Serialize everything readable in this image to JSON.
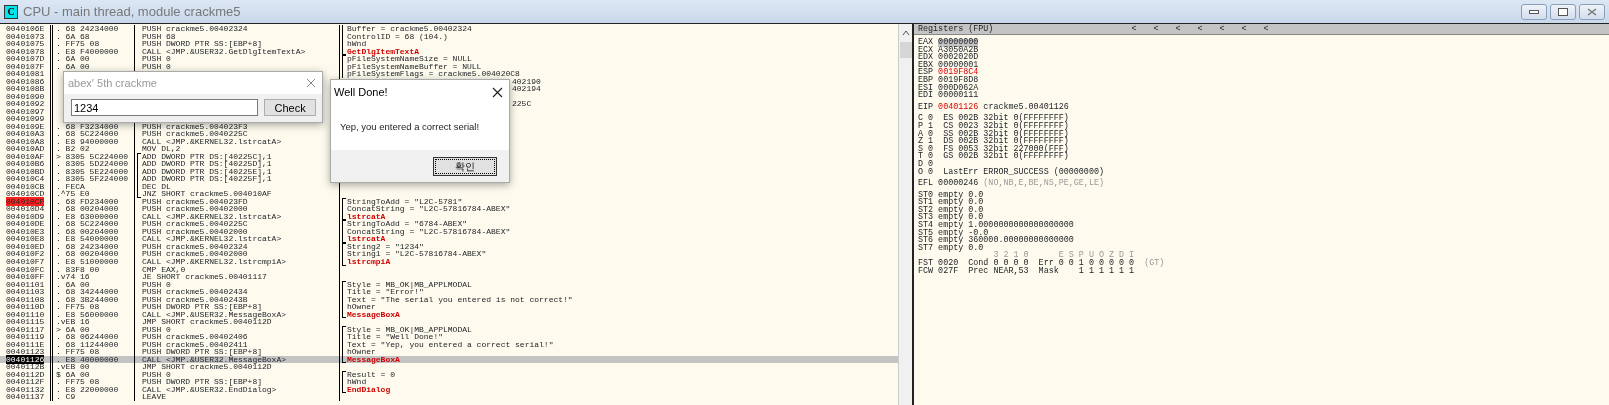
{
  "window": {
    "icon_letter": "C",
    "title": "CPU - main thread, module crackme5"
  },
  "disassembly": {
    "rows": [
      {
        "addr": "0040106E",
        "hex": ". 68 24234000",
        "cmd": "PUSH crackme5.00402324",
        "comment": {
          "text": "Buffer = crackme5.00402324",
          "kind": "arg",
          "bracket_start": false,
          "bracket_end": false
        },
        "selected": false,
        "breakpoint": false,
        "eip": false
      },
      {
        "addr": "00401073",
        "hex": ". 6A 68",
        "cmd": "PUSH 68",
        "comment": {
          "text": "ControlID = 68 (104.)",
          "kind": "arg",
          "bracket_start": false,
          "bracket_end": false
        },
        "selected": false,
        "breakpoint": false,
        "eip": false
      },
      {
        "addr": "00401075",
        "hex": ". FF75 08",
        "cmd": "PUSH DWORD PTR SS:[EBP+8]",
        "comment": {
          "text": "hWnd",
          "kind": "arg",
          "bracket_start": false,
          "bracket_end": false
        },
        "selected": false,
        "breakpoint": false,
        "eip": false
      },
      {
        "addr": "00401078",
        "hex": ". E8 F4000000",
        "cmd": "CALL <JMP.&USER32.GetDlgItemTextA>",
        "comment": {
          "text": "GetDlgItemTextA",
          "kind": "api",
          "bracket_start": false,
          "bracket_end": true
        },
        "selected": false,
        "breakpoint": false,
        "eip": false
      },
      {
        "addr": "0040107D",
        "hex": ". 6A 00",
        "cmd": "PUSH 0",
        "comment": {
          "text": "pFileSystemNameSize = NULL",
          "kind": "arg",
          "bracket_start": true,
          "bracket_end": false
        },
        "selected": false,
        "breakpoint": false,
        "eip": false
      },
      {
        "addr": "0040107F",
        "hex": ". 6A 00",
        "cmd": "PUSH 0",
        "comment": {
          "text": "pFileSystemNameBuffer = NULL",
          "kind": "arg",
          "bracket_start": false,
          "bracket_end": false
        },
        "selected": false,
        "breakpoint": false,
        "eip": false
      },
      {
        "addr": "00401081",
        "comment": {
          "text": "pFileSystemFlags = crackme5.004020C8",
          "kind": "arg",
          "bracket_start": false,
          "bracket_end": false
        },
        "selected": false,
        "breakpoint": false,
        "eip": false
      },
      {
        "addr": "00401086",
        "comment": {
          "text": "402190",
          "kind": "partial"
        },
        "selected": false,
        "breakpoint": false,
        "eip": false
      },
      {
        "addr": "0040108B",
        "comment": {
          "text": "402194",
          "kind": "partial"
        },
        "selected": false,
        "breakpoint": false,
        "eip": false
      },
      {
        "addr": "00401090",
        "selected": false,
        "breakpoint": false,
        "eip": false
      },
      {
        "addr": "00401092",
        "comment": {
          "text": "225C",
          "kind": "partial"
        },
        "selected": false,
        "breakpoint": false,
        "eip": false
      },
      {
        "addr": "00401097",
        "selected": false,
        "breakpoint": false,
        "eip": false
      },
      {
        "addr": "00401099",
        "selected": false,
        "breakpoint": false,
        "eip": false
      },
      {
        "addr": "0040109E",
        "hex": ". 68 F3234000",
        "cmd": "PUSH crackme5.004023F3",
        "selected": false,
        "breakpoint": false,
        "eip": false
      },
      {
        "addr": "004010A3",
        "hex": ". 68 5C224000",
        "cmd": "PUSH crackme5.0040225C",
        "selected": false,
        "breakpoint": false,
        "eip": false
      },
      {
        "addr": "004010A8",
        "hex": ". E8 94000000",
        "cmd": "CALL <JMP.&KERNEL32.lstrcatA>",
        "selected": false,
        "breakpoint": false,
        "eip": false
      },
      {
        "addr": "004010AD",
        "hex": ". B2 02",
        "cmd": "MOV DL,2",
        "selected": false,
        "breakpoint": false,
        "eip": false
      },
      {
        "addr": "004010AF",
        "hex": "> 8305 5C224000",
        "cmd": "ADD DWORD PTR DS:[40225C],1",
        "loop": {
          "start": true,
          "end": false
        },
        "selected": false,
        "breakpoint": false,
        "eip": false
      },
      {
        "addr": "004010B6",
        "hex": ". 8305 5D224000",
        "cmd": "ADD DWORD PTR DS:[40225D],1",
        "loop": {
          "start": false,
          "end": false
        },
        "selected": false,
        "breakpoint": false,
        "eip": false
      },
      {
        "addr": "004010BD",
        "hex": ". 8305 5E224000",
        "cmd": "ADD DWORD PTR DS:[40225E],1",
        "loop": {
          "start": false,
          "end": false
        },
        "selected": false,
        "breakpoint": false,
        "eip": false
      },
      {
        "addr": "004010C4",
        "hex": ". 8305 5F224000",
        "cmd": "ADD DWORD PTR DS:[40225F],1",
        "loop": {
          "start": false,
          "end": false
        },
        "selected": false,
        "breakpoint": false,
        "eip": false
      },
      {
        "addr": "004010CB",
        "hex": ". FECA",
        "cmd": "DEC DL",
        "loop": {
          "start": false,
          "end": false
        },
        "selected": false,
        "breakpoint": false,
        "eip": false
      },
      {
        "addr": "004010CD",
        "hex": ".^75 E0",
        "cmd": "JNZ SHORT crackme5.004010AF",
        "loop": {
          "start": false,
          "end": true
        },
        "selected": false,
        "breakpoint": false,
        "eip": false
      },
      {
        "addr": "004010CF",
        "hex": ". 68 FD234000",
        "cmd": "PUSH crackme5.004023FD",
        "comment": {
          "text": "StringToAdd = \"L2C-5781\"",
          "kind": "arg",
          "bracket_start": true,
          "bracket_end": false
        },
        "selected": false,
        "breakpoint": true,
        "eip": false
      },
      {
        "addr": "004010D4",
        "hex": ". 68 00204000",
        "cmd": "PUSH crackme5.00402000",
        "comment": {
          "text": "ConcatString = \"L2C-57816784-ABEX\"",
          "kind": "arg",
          "bracket_start": false,
          "bracket_end": false
        },
        "selected": false,
        "breakpoint": false,
        "eip": false
      },
      {
        "addr": "004010D9",
        "hex": ". E8 63000000",
        "cmd": "CALL <JMP.&KERNEL32.lstrcatA>",
        "comment": {
          "text": "lstrcatA",
          "kind": "api",
          "bracket_start": false,
          "bracket_end": true
        },
        "selected": false,
        "breakpoint": false,
        "eip": false
      },
      {
        "addr": "004010DE",
        "hex": ". 68 5C224000",
        "cmd": "PUSH crackme5.0040225C",
        "comment": {
          "text": "StringToAdd = \"6784-ABEX\"",
          "kind": "arg",
          "bracket_start": true,
          "bracket_end": false
        },
        "selected": false,
        "breakpoint": false,
        "eip": false
      },
      {
        "addr": "004010E3",
        "hex": ". 68 00204000",
        "cmd": "PUSH crackme5.00402000",
        "comment": {
          "text": "ConcatString = \"L2C-57816784-ABEX\"",
          "kind": "arg",
          "bracket_start": false,
          "bracket_end": false
        },
        "selected": false,
        "breakpoint": false,
        "eip": false
      },
      {
        "addr": "004010E8",
        "hex": ". E8 54000000",
        "cmd": "CALL <JMP.&KERNEL32.lstrcatA>",
        "comment": {
          "text": "lstrcatA",
          "kind": "api",
          "bracket_start": false,
          "bracket_end": true
        },
        "selected": false,
        "breakpoint": false,
        "eip": false
      },
      {
        "addr": "004010ED",
        "hex": ". 68 24234000",
        "cmd": "PUSH crackme5.00402324",
        "comment": {
          "text": "String2 = \"1234\"",
          "kind": "arg",
          "bracket_start": true,
          "bracket_end": false
        },
        "selected": false,
        "breakpoint": false,
        "eip": false
      },
      {
        "addr": "004010F2",
        "hex": ". 68 00204000",
        "cmd": "PUSH crackme5.00402000",
        "comment": {
          "text": "String1 = \"L2C-57816784-ABEX\"",
          "kind": "arg",
          "bracket_start": false,
          "bracket_end": false
        },
        "selected": false,
        "breakpoint": false,
        "eip": false
      },
      {
        "addr": "004010F7",
        "hex": ". E8 51000000",
        "cmd": "CALL <JMP.&KERNEL32.lstrcmpiA>",
        "comment": {
          "text": "lstrcmpiA",
          "kind": "api",
          "bracket_start": false,
          "bracket_end": true
        },
        "selected": false,
        "breakpoint": false,
        "eip": false
      },
      {
        "addr": "004010FC",
        "hex": ". 83F8 00",
        "cmd": "CMP EAX,0",
        "selected": false,
        "breakpoint": false,
        "eip": false
      },
      {
        "addr": "004010FF",
        "hex": ".v74 16",
        "cmd": "JE SHORT crackme5.00401117",
        "selected": false,
        "breakpoint": false,
        "eip": false
      },
      {
        "addr": "00401101",
        "hex": ". 6A 00",
        "cmd": "PUSH 0",
        "comment": {
          "text": "Style = MB_OK|MB_APPLMODAL",
          "kind": "arg",
          "bracket_start": true,
          "bracket_end": false
        },
        "selected": false,
        "breakpoint": false,
        "eip": false
      },
      {
        "addr": "00401103",
        "hex": ". 68 34244000",
        "cmd": "PUSH crackme5.00402434",
        "comment": {
          "text": "Title = \"Error!\"",
          "kind": "arg",
          "bracket_start": false,
          "bracket_end": false
        },
        "selected": false,
        "breakpoint": false,
        "eip": false
      },
      {
        "addr": "00401108",
        "hex": ". 68 3B244000",
        "cmd": "PUSH crackme5.0040243B",
        "comment": {
          "text": "Text = \"The serial you entered is not correct!\"",
          "kind": "arg",
          "bracket_start": false,
          "bracket_end": false
        },
        "selected": false,
        "breakpoint": false,
        "eip": false
      },
      {
        "addr": "0040110D",
        "hex": ". FF75 08",
        "cmd": "PUSH DWORD PTR SS:[EBP+8]",
        "comment": {
          "text": "hOwner",
          "kind": "arg",
          "bracket_start": false,
          "bracket_end": false
        },
        "selected": false,
        "breakpoint": false,
        "eip": false
      },
      {
        "addr": "00401110",
        "hex": ". E8 56000000",
        "cmd": "CALL <JMP.&USER32.MessageBoxA>",
        "comment": {
          "text": "MessageBoxA",
          "kind": "api",
          "bracket_start": false,
          "bracket_end": true
        },
        "selected": false,
        "breakpoint": false,
        "eip": false
      },
      {
        "addr": "00401115",
        "hex": ".vEB 16",
        "cmd": "JMP SHORT crackme5.0040112D",
        "selected": false,
        "breakpoint": false,
        "eip": false
      },
      {
        "addr": "00401117",
        "hex": "> 6A 00",
        "cmd": "PUSH 0",
        "comment": {
          "text": "Style = MB_OK|MB_APPLMODAL",
          "kind": "arg",
          "bracket_start": true,
          "bracket_end": false
        },
        "selected": false,
        "breakpoint": false,
        "eip": false
      },
      {
        "addr": "00401119",
        "hex": ". 68 06244000",
        "cmd": "PUSH crackme5.00402406",
        "comment": {
          "text": "Title = \"Well Done!\"",
          "kind": "arg",
          "bracket_start": false,
          "bracket_end": false
        },
        "selected": false,
        "breakpoint": false,
        "eip": false
      },
      {
        "addr": "0040111E",
        "hex": ". 68 11244000",
        "cmd": "PUSH crackme5.00402411",
        "comment": {
          "text": "Text = \"Yep, you entered a correct serial!\"",
          "kind": "arg",
          "bracket_start": false,
          "bracket_end": false
        },
        "selected": false,
        "breakpoint": false,
        "eip": false
      },
      {
        "addr": "00401123",
        "hex": ". FF75 08",
        "cmd": "PUSH DWORD PTR SS:[EBP+8]",
        "comment": {
          "text": "hOwner",
          "kind": "arg",
          "bracket_start": false,
          "bracket_end": false
        },
        "selected": false,
        "breakpoint": false,
        "eip": false
      },
      {
        "addr": "00401126",
        "hex": ". E8 40000000",
        "cmd": "CALL <JMP.&USER32.MessageBoxA>",
        "comment": {
          "text": "MessageBoxA",
          "kind": "api",
          "bracket_start": false,
          "bracket_end": true
        },
        "selected": true,
        "breakpoint": false,
        "eip": true
      },
      {
        "addr": "0040112B",
        "hex": ".vEB 00",
        "cmd": "JMP SHORT crackme5.0040112D",
        "selected": false,
        "breakpoint": false,
        "eip": false
      },
      {
        "addr": "0040112D",
        "hex": "$ 6A 00",
        "cmd": "PUSH 0",
        "comment": {
          "text": "Result = 0",
          "kind": "arg",
          "bracket_start": true,
          "bracket_end": false
        },
        "selected": false,
        "breakpoint": false,
        "eip": false
      },
      {
        "addr": "0040112F",
        "hex": ". FF75 08",
        "cmd": "PUSH DWORD PTR SS:[EBP+8]",
        "comment": {
          "text": "hWnd",
          "kind": "arg",
          "bracket_start": false,
          "bracket_end": false
        },
        "selected": false,
        "breakpoint": false,
        "eip": false
      },
      {
        "addr": "00401132",
        "hex": ". E8 22000000",
        "cmd": "CALL <JMP.&USER32.EndDialog>",
        "comment": {
          "text": "EndDialog",
          "kind": "api",
          "bracket_start": false,
          "bracket_end": true
        },
        "selected": false,
        "breakpoint": false,
        "eip": false
      },
      {
        "addr": "00401137",
        "hex": ". C9",
        "cmd": "LEAVE",
        "selected": false,
        "breakpoint": false,
        "eip": false
      }
    ]
  },
  "registers": {
    "title": "Registers (FPU)",
    "arrows": [
      "<",
      "<",
      "<",
      "<",
      "<",
      "<",
      "<"
    ],
    "groups": [
      [
        [
          {
            "t": "EAX "
          },
          {
            "t": "00000000",
            "kind": "selected"
          }
        ],
        [
          {
            "t": "ECX A3050A2B"
          }
        ],
        [
          {
            "t": "EDX 0002020D"
          }
        ],
        [
          {
            "t": "EBX 00000001"
          }
        ],
        [
          {
            "t": "ESP "
          },
          {
            "t": "0019F8C4",
            "kind": "changed"
          }
        ],
        [
          {
            "t": "EBP 0019F8D8"
          }
        ],
        [
          {
            "t": "ESI 000D062A"
          }
        ],
        [
          {
            "t": "EDI 00000111"
          }
        ]
      ],
      [
        [
          {
            "t": "EIP "
          },
          {
            "t": "00401126",
            "kind": "changed"
          },
          {
            "t": " crackme5.00401126"
          }
        ]
      ],
      [
        [
          {
            "t": "C 0  ES 002B 32bit 0(FFFFFFFF)"
          }
        ],
        [
          {
            "t": "P 1  CS 0023 32bit 0(FFFFFFFF)"
          }
        ],
        [
          {
            "t": "A 0  SS 002B 32bit 0(FFFFFFFF)"
          }
        ],
        [
          {
            "t": "Z 1  DS 002B 32bit 0(FFFFFFFF)"
          }
        ],
        [
          {
            "t": "S 0  FS 0053 32bit 227000(FFF)"
          }
        ],
        [
          {
            "t": "T 0  GS 002B 32bit 0(FFFFFFFF)"
          }
        ],
        [
          {
            "t": "D 0"
          }
        ],
        [
          {
            "t": "O 0  LastErr ERROR_SUCCESS (00000000)"
          }
        ]
      ],
      [
        [
          {
            "t": "EFL 00000246 "
          },
          {
            "t": "(NO,NB,E,BE,NS,PE,GE,LE)",
            "kind": "dim"
          }
        ]
      ],
      [
        [
          {
            "t": "ST0 empty 0.0"
          }
        ],
        [
          {
            "t": "ST1 empty 0.0"
          }
        ],
        [
          {
            "t": "ST2 empty 0.0"
          }
        ],
        [
          {
            "t": "ST3 empty 0.0"
          }
        ],
        [
          {
            "t": "ST4 empty 1.0000000000000000000"
          }
        ],
        [
          {
            "t": "ST5 empty -0.0"
          }
        ],
        [
          {
            "t": "ST6 empty 360000.00000000000000"
          }
        ],
        [
          {
            "t": "ST7 empty 0.0"
          }
        ],
        [
          {
            "t": "               3 2 1 0      E S P U O Z D I",
            "kind": "dim"
          }
        ],
        [
          {
            "t": "FST 0020  Cond 0 0 0 0  Err 0 0 1 0 0 0 0 0  "
          },
          {
            "t": "(GT)",
            "kind": "dim"
          }
        ],
        [
          {
            "t": "FCW 027F  Prec NEAR,53  Mask    1 1 1 1 1 1"
          }
        ]
      ]
    ]
  },
  "crackme_dialog": {
    "title": "abex' 5th crackme",
    "input_value": "1234",
    "button": "Check"
  },
  "message_box": {
    "title": "Well Done!",
    "text": "Yep, you entered a correct serial!",
    "button": "확인",
    "button_focused": true
  }
}
